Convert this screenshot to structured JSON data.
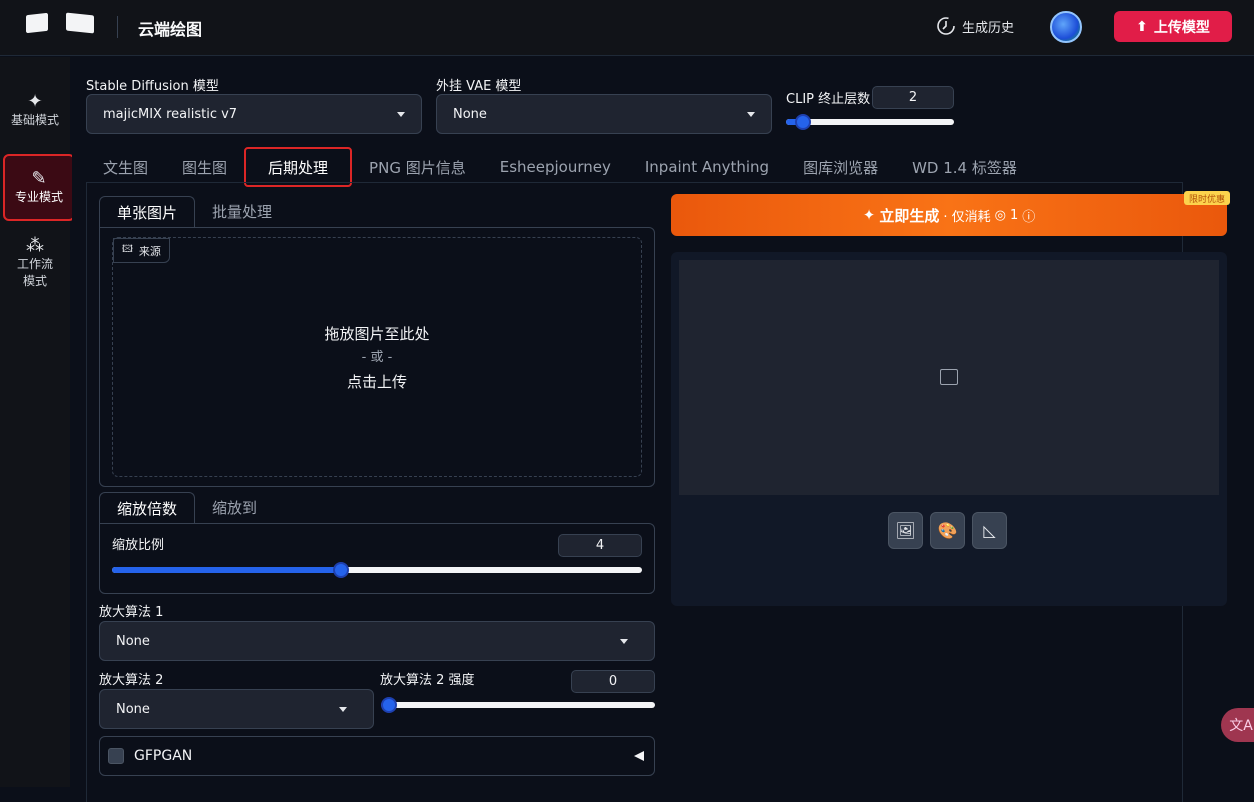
{
  "header": {
    "title": "云端绘图",
    "history_label": "生成历史",
    "upload_label": "上传模型"
  },
  "sidebar": {
    "items": [
      {
        "label": "基础模式",
        "icon": "sparkle-icon"
      },
      {
        "label": "专业模式",
        "icon": "brush-icon",
        "active": true
      },
      {
        "label_line1": "工作流",
        "label_line2": "模式",
        "icon": "workflow-icon"
      }
    ]
  },
  "model": {
    "sd_label": "Stable Diffusion 模型",
    "sd_value": "majicMIX realistic v7",
    "vae_label": "外挂 VAE 模型",
    "vae_value": "None",
    "clip_label": "CLIP 终止层数",
    "clip_value": "2",
    "clip_fraction": 0.06
  },
  "tabs": [
    "文生图",
    "图生图",
    "后期处理",
    "PNG 图片信息",
    "Esheepjourney",
    "Inpaint Anything",
    "图库浏览器",
    "WD 1.4 标签器"
  ],
  "active_tab": "后期处理",
  "left": {
    "subtabs": [
      "单张图片",
      "批量处理"
    ],
    "source_label": "来源",
    "drop_line1": "拖放图片至此处",
    "drop_or": "- 或 -",
    "drop_line2": "点击上传",
    "scale_tabs": [
      "缩放倍数",
      "缩放到"
    ],
    "scale_label": "缩放比例",
    "scale_value": "4",
    "scale_fraction": 0.43,
    "upscaler1_label": "放大算法 1",
    "upscaler1_value": "None",
    "upscaler2_label": "放大算法 2",
    "upscaler2_value": "None",
    "upscaler2_strength_label": "放大算法 2 强度",
    "upscaler2_strength_value": "0",
    "upscaler2_strength_fraction": 0.0,
    "gfpgan_label": "GFPGAN"
  },
  "right": {
    "generate_label": "立即生成",
    "generate_sub": "· 仅消耗",
    "generate_cost": "1",
    "promo_badge": "限时优惠"
  },
  "colors": {
    "accent_red": "#e11d48",
    "highlight_red": "#dc2626",
    "generate_orange": "#f97316",
    "slider_blue": "#2563eb"
  },
  "translate_icon": "文A"
}
